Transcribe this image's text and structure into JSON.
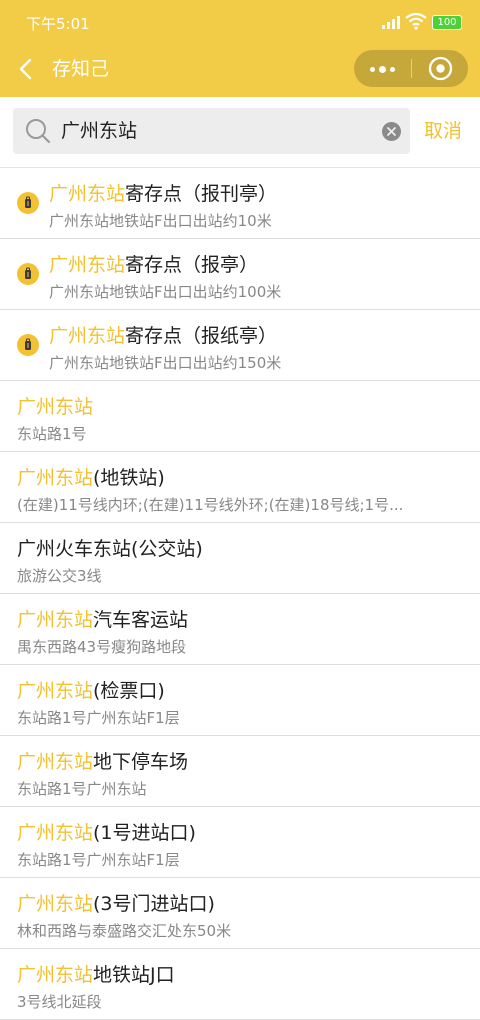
{
  "status_bar": {
    "time": "下午5:01",
    "battery": "100"
  },
  "nav": {
    "title": "存知己"
  },
  "colors": {
    "brand": "#f2cc46",
    "highlight": "#f2c232",
    "text": "#222222",
    "sub": "#888888"
  },
  "search": {
    "value": "广州东站",
    "cancel_label": "取消"
  },
  "results": [
    {
      "type": "pin",
      "hl": "广州东站",
      "rest": "寄存点（报刊亭）",
      "sub": "广州东站地铁站F出口出站约10米"
    },
    {
      "type": "pin",
      "hl": "广州东站",
      "rest": "寄存点（报亭）",
      "sub": "广州东站地铁站F出口出站约100米"
    },
    {
      "type": "pin",
      "hl": "广州东站",
      "rest": "寄存点（报纸亭）",
      "sub": "广州东站地铁站F出口出站约150米"
    },
    {
      "type": "place",
      "hl": "广州东站",
      "rest": "",
      "sub": "东站路1号"
    },
    {
      "type": "place",
      "hl": "广州东站",
      "rest": "(地铁站)",
      "sub": "(在建)11号线内环;(在建)11号线外环;(在建)18号线;1号..."
    },
    {
      "type": "place",
      "hl": "",
      "rest": "广州火车东站(公交站)",
      "sub": "旅游公交3线"
    },
    {
      "type": "place",
      "hl": "广州东站",
      "rest": "汽车客运站",
      "sub": "禺东西路43号瘦狗路地段"
    },
    {
      "type": "place",
      "hl": "广州东站",
      "rest": "(检票口)",
      "sub": "东站路1号广州东站F1层"
    },
    {
      "type": "place",
      "hl": "广州东站",
      "rest": "地下停车场",
      "sub": "东站路1号广州东站"
    },
    {
      "type": "place",
      "hl": "广州东站",
      "rest": "(1号进站口)",
      "sub": "东站路1号广州东站F1层"
    },
    {
      "type": "place",
      "hl": "广州东站",
      "rest": "(3号门进站口)",
      "sub": "林和西路与泰盛路交汇处东50米"
    },
    {
      "type": "place",
      "hl": "广州东站",
      "rest": "地铁站J口",
      "sub": "3号线北延段"
    }
  ]
}
